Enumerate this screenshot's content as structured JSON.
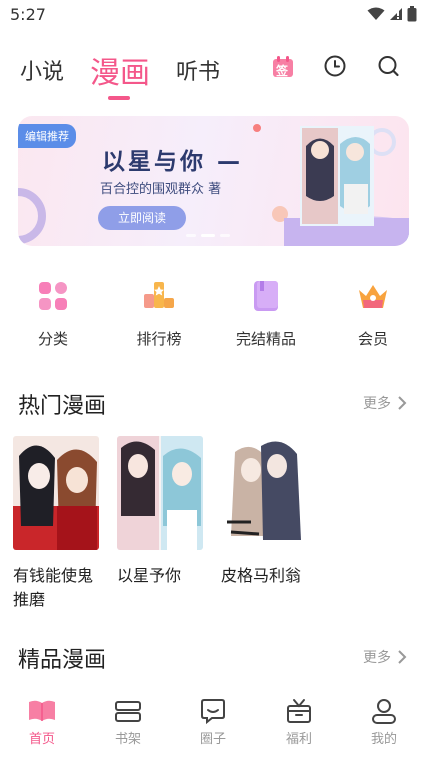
{
  "status_bar": {
    "time": "5:27"
  },
  "top_nav": {
    "tabs": [
      {
        "label": "小说"
      },
      {
        "label": "漫画"
      },
      {
        "label": "听书"
      }
    ],
    "active_tab": "漫画",
    "checkin_icon_label": "签"
  },
  "banner": {
    "tag": "编辑推荐",
    "title": "以星与你 —",
    "subtitle": "百合控的围观群众 著",
    "button": "立即阅读"
  },
  "categories": [
    {
      "label": "分类",
      "icon": "grid-icon"
    },
    {
      "label": "排行榜",
      "icon": "trophy-icon"
    },
    {
      "label": "完结精品",
      "icon": "book-icon"
    },
    {
      "label": "会员",
      "icon": "crown-icon"
    }
  ],
  "hot_section": {
    "title": "热门漫画",
    "more": "更多",
    "books": [
      {
        "title": "有钱能使鬼推磨"
      },
      {
        "title": "以星予你"
      },
      {
        "title": "皮格马利翁"
      }
    ]
  },
  "premium_section": {
    "title": "精品漫画",
    "more": "更多"
  },
  "bottom_nav": {
    "items": [
      {
        "label": "首页"
      },
      {
        "label": "书架"
      },
      {
        "label": "圈子"
      },
      {
        "label": "福利"
      },
      {
        "label": "我的"
      }
    ],
    "active": "首页"
  },
  "colors": {
    "accent": "#f4578a",
    "inactive": "#999999",
    "banner_tag": "#5b8de8"
  }
}
